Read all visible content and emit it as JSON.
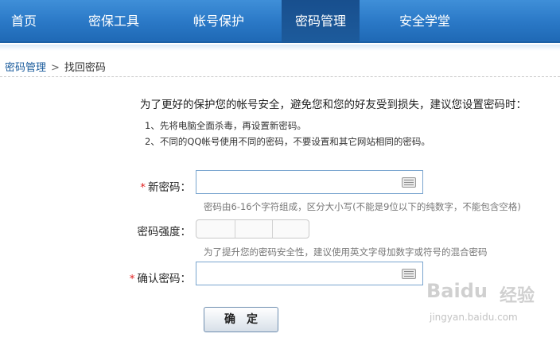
{
  "nav": {
    "items": [
      {
        "label": "首页"
      },
      {
        "label": "密保工具"
      },
      {
        "label": "帐号保护"
      },
      {
        "label": "密码管理"
      },
      {
        "label": "安全学堂"
      }
    ],
    "active": "密码管理"
  },
  "breadcrumb": {
    "parent": "密码管理",
    "separator": ">",
    "current": "找回密码"
  },
  "intro": {
    "text": "为了更好的保护您的帐号安全，避免您和您的好友受到损失，建议您设置密码时：",
    "tips": [
      "1、先将电脑全面杀毒，再设置新密码。",
      "2、不同的QQ帐号使用不同的密码，不要设置和其它网站相同的密码。"
    ]
  },
  "form": {
    "required_mark": "*",
    "new_password_label": "新密码：",
    "new_password_value": "",
    "new_password_hint": "密码由6-16个字符组成，区分大小写(不能是9位以下的纯数字，不能包含空格)",
    "strength_label": "密码强度：",
    "strength_hint": "为了提升您的密码安全性，建议使用英文字母加数字或符号的混合密码",
    "confirm_password_label": "确认密码：",
    "confirm_password_value": "",
    "submit_label": "确定"
  },
  "watermark": {
    "logo_text": "Baidu",
    "logo_cn": "经验",
    "url": "jingyan.baidu.com"
  },
  "colors": {
    "nav_bg": "#2a78c6",
    "nav_active": "#1d5b9c",
    "required": "#e02020",
    "input_border": "#7aa5cf"
  },
  "icons": [
    "keyboard-icon"
  ]
}
